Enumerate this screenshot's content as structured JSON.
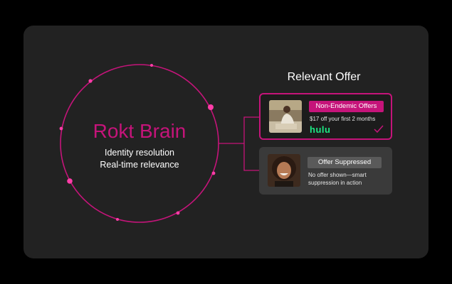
{
  "brain": {
    "title": "Rokt Brain",
    "lines": [
      "Identity resolution",
      "Real-time relevance"
    ]
  },
  "offers": {
    "heading": "Relevant Offer",
    "cards": [
      {
        "tag": "Non-Endemic Offers",
        "text": "$17 off your first 2 months",
        "brand": "hulu",
        "state": "selected",
        "icon": "checkmark-icon"
      },
      {
        "tag": "Offer Suppressed",
        "text": "No offer shown—smart suppression in action",
        "state": "suppressed"
      }
    ]
  },
  "colors": {
    "accent": "#c5147a",
    "panel": "#222222",
    "background": "#000000",
    "brand_green": "#1ce783",
    "suppressed_card": "#3a3a3a"
  }
}
